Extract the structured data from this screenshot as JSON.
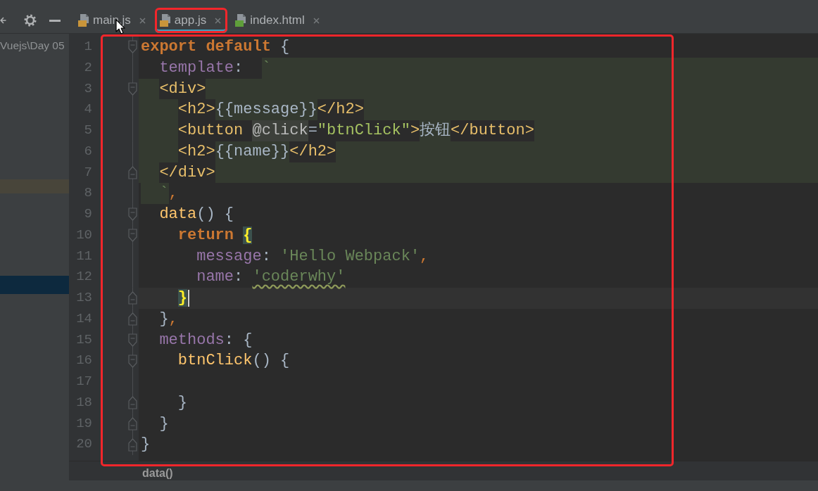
{
  "tabs": [
    {
      "label": "main.js",
      "kind": "js",
      "selected": false,
      "circled": false
    },
    {
      "label": "app.js",
      "kind": "js",
      "selected": true,
      "circled": true
    },
    {
      "label": "index.html",
      "kind": "html",
      "selected": false,
      "circled": false
    }
  ],
  "project_panel": {
    "path": "Vuejs\\Day 05",
    "rows": [
      {
        "highlighted": true,
        "selected": false
      },
      {
        "highlighted": false,
        "selected": true
      }
    ]
  },
  "editor": {
    "framed": true,
    "lines": [
      {
        "number": "1",
        "fold_start": true,
        "fold_end": false,
        "embedded": false,
        "current": false,
        "caret": false,
        "tokens": [
          {
            "kind": "keyword",
            "text": "export default"
          },
          {
            "kind": "punct",
            "text": " {"
          }
        ]
      },
      {
        "number": "2",
        "fold_start": false,
        "fold_end": false,
        "embedded": false,
        "current": false,
        "caret": false,
        "tokens": [
          {
            "kind": "property",
            "text": "  template"
          },
          {
            "kind": "punct",
            "text": ":"
          },
          {
            "kind": "template-quote",
            "text": "  `"
          }
        ]
      },
      {
        "number": "3",
        "fold_start": true,
        "fold_end": false,
        "embedded": true,
        "current": false,
        "caret": false,
        "tokens": [
          {
            "kind": "tag",
            "text": "  <div>"
          }
        ]
      },
      {
        "number": "4",
        "fold_start": false,
        "fold_end": false,
        "embedded": true,
        "current": false,
        "caret": false,
        "tokens": [
          {
            "kind": "tag",
            "text": "    <h2>"
          },
          {
            "kind": "text",
            "text": "{{message}}"
          },
          {
            "kind": "tag",
            "text": "</h2>"
          }
        ]
      },
      {
        "number": "5",
        "fold_start": false,
        "fold_end": false,
        "embedded": true,
        "current": false,
        "caret": false,
        "tokens": [
          {
            "kind": "tag",
            "text": "    <button "
          },
          {
            "kind": "attr",
            "text": "@click"
          },
          {
            "kind": "tag-eq",
            "text": "="
          },
          {
            "kind": "attr-value",
            "text": "\"btnClick\""
          },
          {
            "kind": "tag",
            "text": ">"
          },
          {
            "kind": "text",
            "text": "按钮"
          },
          {
            "kind": "tag",
            "text": "</button>"
          }
        ]
      },
      {
        "number": "6",
        "fold_start": false,
        "fold_end": false,
        "embedded": true,
        "current": false,
        "caret": false,
        "tokens": [
          {
            "kind": "tag",
            "text": "    <h2>"
          },
          {
            "kind": "text",
            "text": "{{name}}"
          },
          {
            "kind": "tag",
            "text": "</h2>"
          }
        ]
      },
      {
        "number": "7",
        "fold_start": false,
        "fold_end": true,
        "embedded": true,
        "current": false,
        "caret": false,
        "tokens": [
          {
            "kind": "tag",
            "text": "  </div>"
          }
        ]
      },
      {
        "number": "8",
        "fold_start": false,
        "fold_end": false,
        "embedded": false,
        "current": false,
        "caret": false,
        "tokens": [
          {
            "kind": "template-quote",
            "text": "  `"
          },
          {
            "kind": "comma",
            "text": ","
          }
        ]
      },
      {
        "number": "9",
        "fold_start": true,
        "fold_end": false,
        "embedded": false,
        "current": false,
        "caret": false,
        "tokens": [
          {
            "kind": "function",
            "text": "  data"
          },
          {
            "kind": "punct",
            "text": "() {"
          }
        ]
      },
      {
        "number": "10",
        "fold_start": true,
        "fold_end": false,
        "embedded": false,
        "current": false,
        "caret": false,
        "tokens": [
          {
            "kind": "keyword",
            "text": "    return"
          },
          {
            "kind": "brace-match",
            "text": " {"
          }
        ]
      },
      {
        "number": "11",
        "fold_start": false,
        "fold_end": false,
        "embedded": false,
        "current": false,
        "caret": false,
        "tokens": [
          {
            "kind": "property",
            "text": "      message"
          },
          {
            "kind": "punct",
            "text": ": "
          },
          {
            "kind": "string",
            "text": "'Hello Webpack'"
          },
          {
            "kind": "comma",
            "text": ","
          }
        ]
      },
      {
        "number": "12",
        "fold_start": false,
        "fold_end": false,
        "embedded": false,
        "current": false,
        "caret": false,
        "tokens": [
          {
            "kind": "property",
            "text": "      name"
          },
          {
            "kind": "punct",
            "text": ": "
          },
          {
            "kind": "typo-string",
            "text": "'coderwhy'"
          }
        ]
      },
      {
        "number": "13",
        "fold_start": false,
        "fold_end": true,
        "embedded": false,
        "current": true,
        "caret": true,
        "tokens": [
          {
            "kind": "brace-match",
            "text": "    }"
          }
        ]
      },
      {
        "number": "14",
        "fold_start": false,
        "fold_end": true,
        "embedded": false,
        "current": false,
        "caret": false,
        "tokens": [
          {
            "kind": "punct",
            "text": "  }"
          },
          {
            "kind": "comma",
            "text": ","
          }
        ]
      },
      {
        "number": "15",
        "fold_start": true,
        "fold_end": false,
        "embedded": false,
        "current": false,
        "caret": false,
        "tokens": [
          {
            "kind": "property",
            "text": "  methods"
          },
          {
            "kind": "punct",
            "text": ": {"
          }
        ]
      },
      {
        "number": "16",
        "fold_start": true,
        "fold_end": false,
        "embedded": false,
        "current": false,
        "caret": false,
        "tokens": [
          {
            "kind": "function",
            "text": "    btnClick"
          },
          {
            "kind": "punct",
            "text": "() {"
          }
        ]
      },
      {
        "number": "17",
        "fold_start": false,
        "fold_end": false,
        "embedded": false,
        "current": false,
        "caret": false
      },
      {
        "number": "18",
        "fold_start": false,
        "fold_end": true,
        "embedded": false,
        "current": false,
        "caret": false,
        "tokens": [
          {
            "kind": "punct",
            "text": "    }"
          }
        ]
      },
      {
        "number": "19",
        "fold_start": false,
        "fold_end": true,
        "embedded": false,
        "current": false,
        "caret": false,
        "tokens": [
          {
            "kind": "punct",
            "text": "  }"
          }
        ]
      },
      {
        "number": "20",
        "fold_start": false,
        "fold_end": true,
        "embedded": false,
        "current": false,
        "caret": false,
        "tokens": [
          {
            "kind": "punct",
            "text": "}"
          }
        ]
      }
    ]
  },
  "breadcrumb": [
    {
      "label": "data()"
    }
  ]
}
